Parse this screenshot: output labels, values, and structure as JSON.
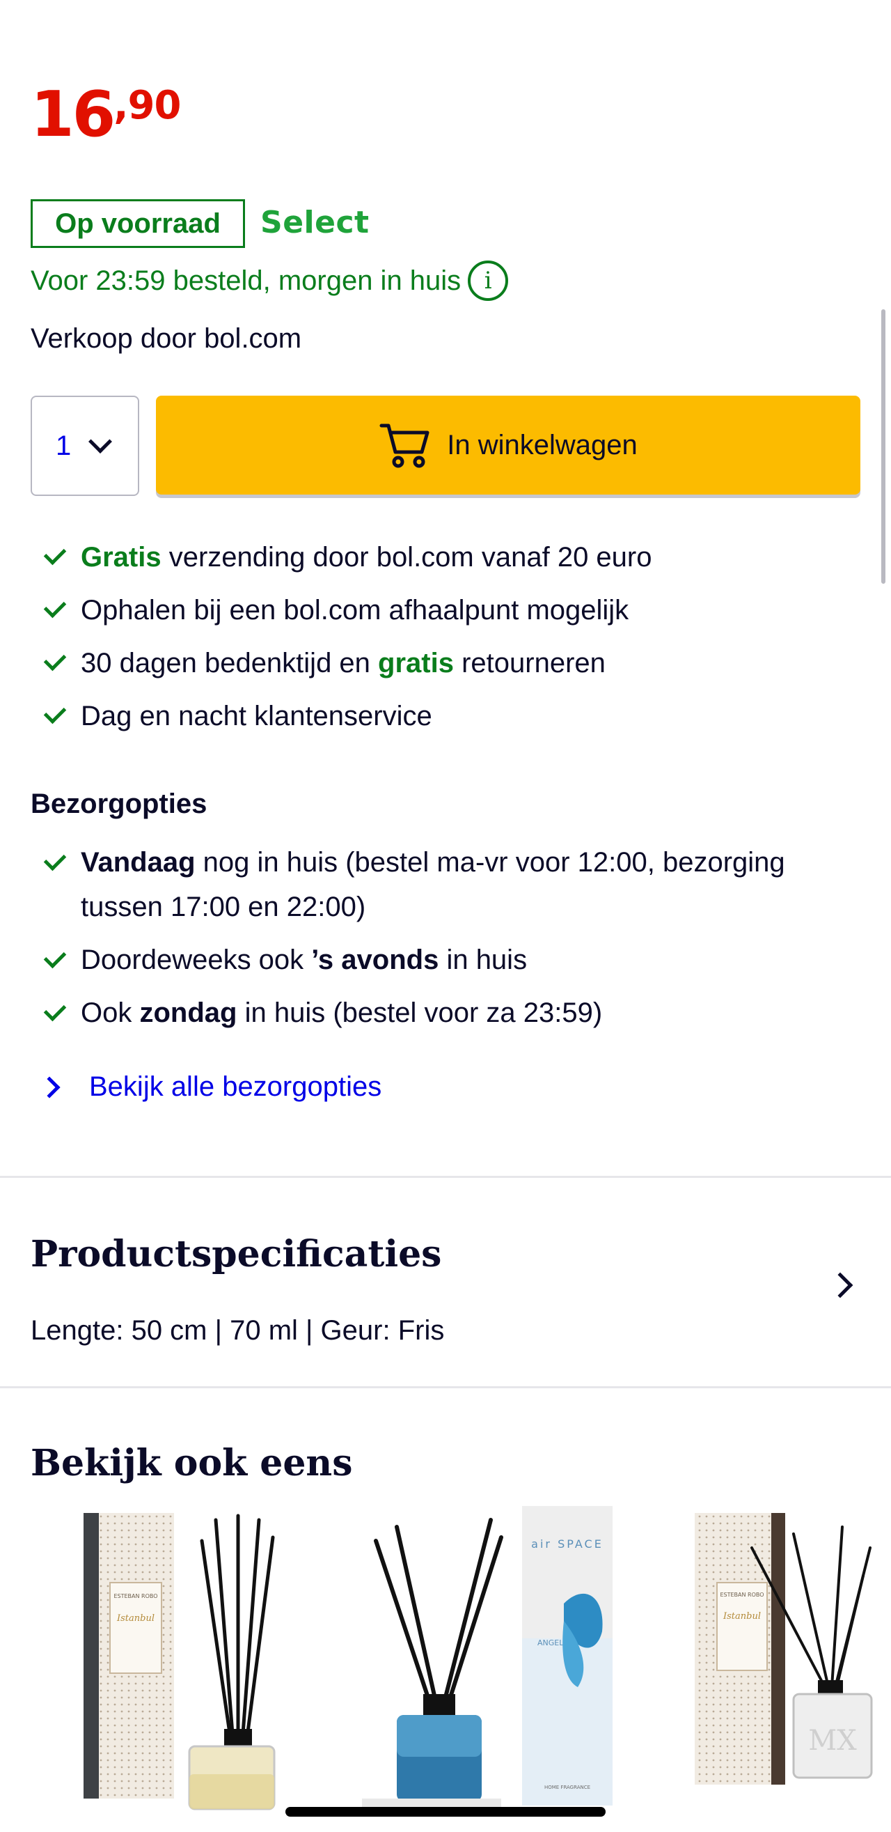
{
  "price": {
    "euros": "16",
    "separator": ",",
    "cents": "90"
  },
  "stock": {
    "badge": "Op voorraad",
    "select": "Select"
  },
  "delivery": {
    "line": "Voor 23:59 besteld, morgen in huis",
    "info_icon": "info-icon"
  },
  "seller": "Verkoop door bol.com",
  "quantity": {
    "value": "1"
  },
  "cart_button": {
    "label": "In winkelwagen",
    "icon": "shopping-cart-icon"
  },
  "usps": [
    {
      "bold": "Gratis",
      "rest": " verzending door bol.com vanaf 20 euro"
    },
    {
      "text": "Ophalen bij een bol.com afhaalpunt mogelijk"
    },
    {
      "pre": "30 dagen bedenktijd en ",
      "bold": "gratis",
      "post": " retourneren"
    },
    {
      "text": "Dag en nacht klantenservice"
    }
  ],
  "delivery_options": {
    "title": "Bezorgopties",
    "items": [
      {
        "bold": "Vandaag",
        "rest": " nog in huis (bestel ma-vr voor 12:00, bezorging tussen 17:00 en 22:00)"
      },
      {
        "pre": "Doordeweeks ook ",
        "bold": "’s avonds",
        "post": " in huis"
      },
      {
        "pre": "Ook ",
        "bold": "zondag",
        "post": " in huis (bestel voor za 23:59)"
      }
    ],
    "more_link": "Bekijk alle bezorgopties"
  },
  "specifications": {
    "title": "Productspecificaties",
    "summary": "Lengte: 50 cm | 70 ml | Geur: Fris"
  },
  "also_see": {
    "title": "Bekijk ook eens",
    "products": [
      {
        "box_brand": "ESTEBAN ROBO",
        "box_label": "Istanbul"
      },
      {
        "box_brand": "air SPACE",
        "box_label": "ANGEL",
        "box_footer": "HOME FRAGRANCE"
      },
      {
        "box_brand": "ESTEBAN ROBO",
        "box_label": "Istanbul"
      }
    ]
  },
  "colors": {
    "price_red": "#e11000",
    "stock_green": "#0a7d1c",
    "select_green": "#1fa33a",
    "link_blue": "#0000e6",
    "cart_yellow": "#fcbb00",
    "text_dark": "#0b0b28"
  }
}
